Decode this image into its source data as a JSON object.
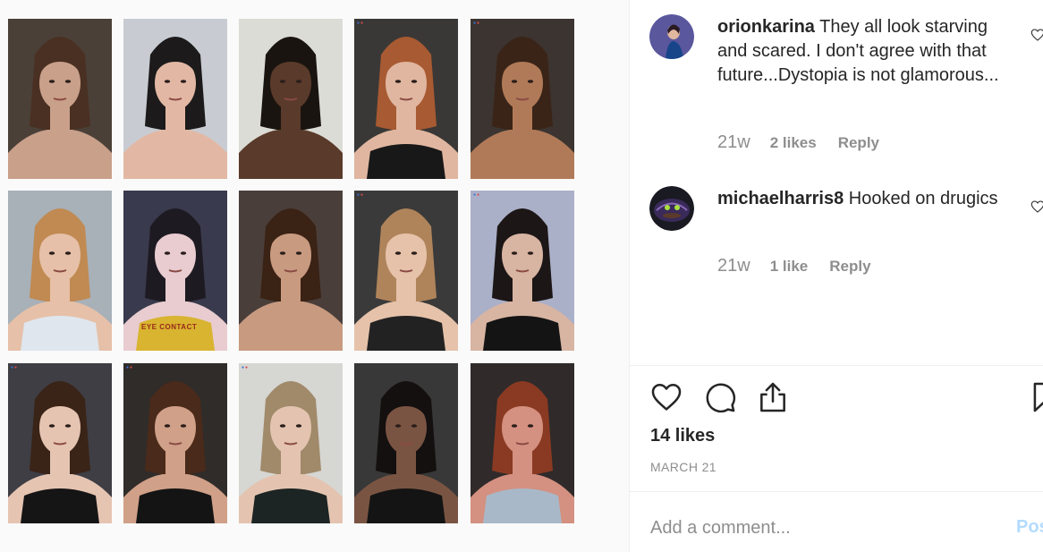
{
  "post": {
    "image_alt": "Grid of fifteen portrait headshots",
    "photos": [
      {
        "bg": "#4a4038",
        "skin": "#c9a08a",
        "hair": "#4a3022",
        "shirt": "#c9a08a"
      },
      {
        "bg": "#c8ccd2",
        "skin": "#e2b8a4",
        "hair": "#1c1a1a",
        "shirt": "#e2b8a4"
      },
      {
        "bg": "#dcdcd6",
        "skin": "#5a3a2a",
        "hair": "#1a1410",
        "shirt": "#5a3a2a"
      },
      {
        "bg": "#3a3836",
        "skin": "#e0b6a0",
        "hair": "#a85a32",
        "shirt": "#181818"
      },
      {
        "bg": "#3c3430",
        "skin": "#b07a58",
        "hair": "#3a2418",
        "shirt": "#b07a58"
      },
      {
        "bg": "#a8b0b8",
        "skin": "#e6c0a8",
        "hair": "#c08a52",
        "shirt": "#dfe6ee"
      },
      {
        "bg": "#3a3a4e",
        "skin": "#e8ccd0",
        "hair": "#1e1a22",
        "shirt": "#d8b430"
      },
      {
        "bg": "#4a3e3a",
        "skin": "#c89a80",
        "hair": "#3a2214",
        "shirt": "#c89a80"
      },
      {
        "bg": "#3a3a3a",
        "skin": "#e6c2aa",
        "hair": "#b0845a",
        "shirt": "#222222"
      },
      {
        "bg": "#aab0c8",
        "skin": "#d8b4a2",
        "hair": "#1c1616",
        "shirt": "#141414"
      },
      {
        "bg": "#3e3e44",
        "skin": "#e6c4b2",
        "hair": "#3a2418",
        "shirt": "#151515"
      },
      {
        "bg": "#302c2a",
        "skin": "#d0a088",
        "hair": "#4a2a1a",
        "shirt": "#141414"
      },
      {
        "bg": "#d6d6d2",
        "skin": "#e4c4b0",
        "hair": "#a08a6a",
        "shirt": "#1c2424"
      },
      {
        "bg": "#383838",
        "skin": "#7a5442",
        "hair": "#141010",
        "shirt": "#141414"
      },
      {
        "bg": "#302a2a",
        "skin": "#d49080",
        "hair": "#8a3a22",
        "shirt": "#a8b8c8"
      }
    ],
    "shirt_text_6": "EYE CONTACT"
  },
  "comments": [
    {
      "username": "orionkarina",
      "text": "They all look starving and scared. I don't agree with that future...Dystopia is not glamorous...",
      "time": "21w",
      "likes": "2 likes",
      "reply": "Reply",
      "avatar_color": "#1f5fa8"
    },
    {
      "username": "michaelharris8",
      "text": "Hooked on drugics",
      "time": "21w",
      "likes": "1 like",
      "reply": "Reply",
      "avatar_color": "#2a2a3a"
    }
  ],
  "actions": {
    "icons": [
      "heart-icon",
      "comment-icon",
      "share-icon",
      "bookmark-icon"
    ]
  },
  "likes_count": "14 likes",
  "post_date": "MARCH 21",
  "comment_box": {
    "placeholder": "Add a comment...",
    "post_label": "Post"
  },
  "colors": {
    "text": "#262626",
    "muted": "#8e8e8e",
    "post_button": "#b3dbff",
    "divider": "#efefef"
  }
}
